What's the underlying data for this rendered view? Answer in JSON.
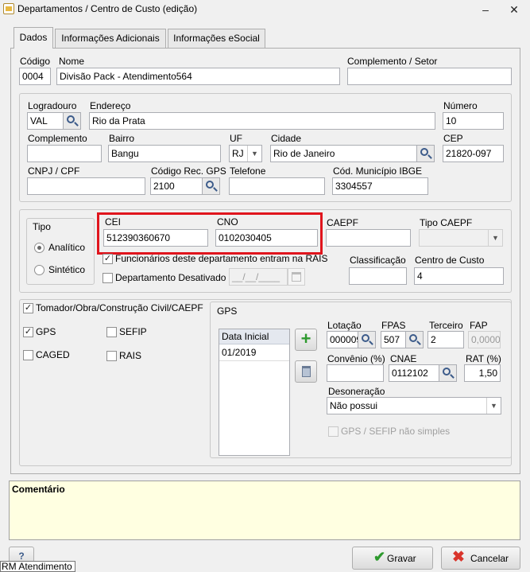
{
  "window": {
    "title": "Departamentos / Centro de Custo (edição)",
    "minimize": "–",
    "close": "✕"
  },
  "tabs": [
    {
      "label": "Dados"
    },
    {
      "label": "Informações Adicionais"
    },
    {
      "label": "Informações eSocial"
    }
  ],
  "header": {
    "codigo_label": "Código",
    "codigo_value": "0004",
    "nome_label": "Nome",
    "nome_value": "Divisão Pack - Atendimento564",
    "complemento_setor_label": "Complemento / Setor",
    "complemento_setor_value": ""
  },
  "address": {
    "logradouro_label": "Logradouro",
    "logradouro_value": "VAL",
    "endereco_label": "Endereço",
    "endereco_value": "Rio da Prata",
    "numero_label": "Número",
    "numero_value": "10",
    "complemento_label": "Complemento",
    "complemento_value": "",
    "bairro_label": "Bairro",
    "bairro_value": "Bangu",
    "uf_label": "UF",
    "uf_value": "RJ",
    "cidade_label": "Cidade",
    "cidade_value": "Rio de Janeiro",
    "cep_label": "CEP",
    "cep_value": "21820-097",
    "cnpj_label": "CNPJ / CPF",
    "cnpj_value": "",
    "cod_rec_gps_label": "Código Rec. GPS",
    "cod_rec_gps_value": "2100",
    "telefone_label": "Telefone",
    "telefone_value": "",
    "cod_municipio_label": "Cód. Município IBGE",
    "cod_municipio_value": "3304557"
  },
  "tipo": {
    "legend": "Tipo",
    "analitico": "Analítico",
    "sintetico": "Sintético",
    "selected": "analitico"
  },
  "registration": {
    "cei_label": "CEI",
    "cei_value": "512390360670",
    "cno_label": "CNO",
    "cno_value": "0102030405",
    "caepf_label": "CAEPF",
    "caepf_value": "",
    "tipo_caepf_label": "Tipo CAEPF",
    "tipo_caepf_value": "",
    "funcionarios_label": "Funcionários deste departamento entram na RAIS",
    "funcionarios_checked": "✓",
    "desativado_label": "Departamento Desativado",
    "desativado_date": "__/__/____",
    "classificacao_label": "Classificação",
    "classificacao_value": "",
    "centro_custo_label": "Centro de Custo",
    "centro_custo_value": "4"
  },
  "obligations": {
    "tomador_label": "Tomador/Obra/Construção Civil/CAEPF",
    "tomador_checked": "✓",
    "gps_label": "GPS",
    "gps_checked": "✓",
    "sefip_label": "SEFIP",
    "caged_label": "CAGED",
    "rais_label": "RAIS"
  },
  "gps": {
    "legend": "GPS",
    "grid_header": "Data Inicial",
    "grid_rows": [
      "01/2019"
    ],
    "add_icon": "+",
    "lotacao_label": "Lotação",
    "lotacao_value": "000009",
    "fpas_label": "FPAS",
    "fpas_value": "507",
    "terceiro_label": "Terceiro",
    "terceiro_value": "2",
    "fap_label": "FAP",
    "fap_value": "0,0000",
    "convenio_label": "Convênio (%)",
    "convenio_value": "",
    "cnae_label": "CNAE",
    "cnae_value": "0112102",
    "rat_label": "RAT (%)",
    "rat_value": "1,50",
    "desoneracao_label": "Desoneração",
    "desoneracao_value": "Não possui",
    "gps_sefip_label": "GPS / SEFIP não simples"
  },
  "comment": {
    "label": "Comentário"
  },
  "footer": {
    "help": "?",
    "gravar": "Gravar",
    "cancelar": "Cancelar",
    "tooltip": "RM Atendimento"
  },
  "colors": {
    "highlight_border": "#e0151d",
    "comment_bg": "#ffffe1",
    "gravar_icon": "#2e9a2e",
    "cancel_icon": "#d9342b"
  }
}
